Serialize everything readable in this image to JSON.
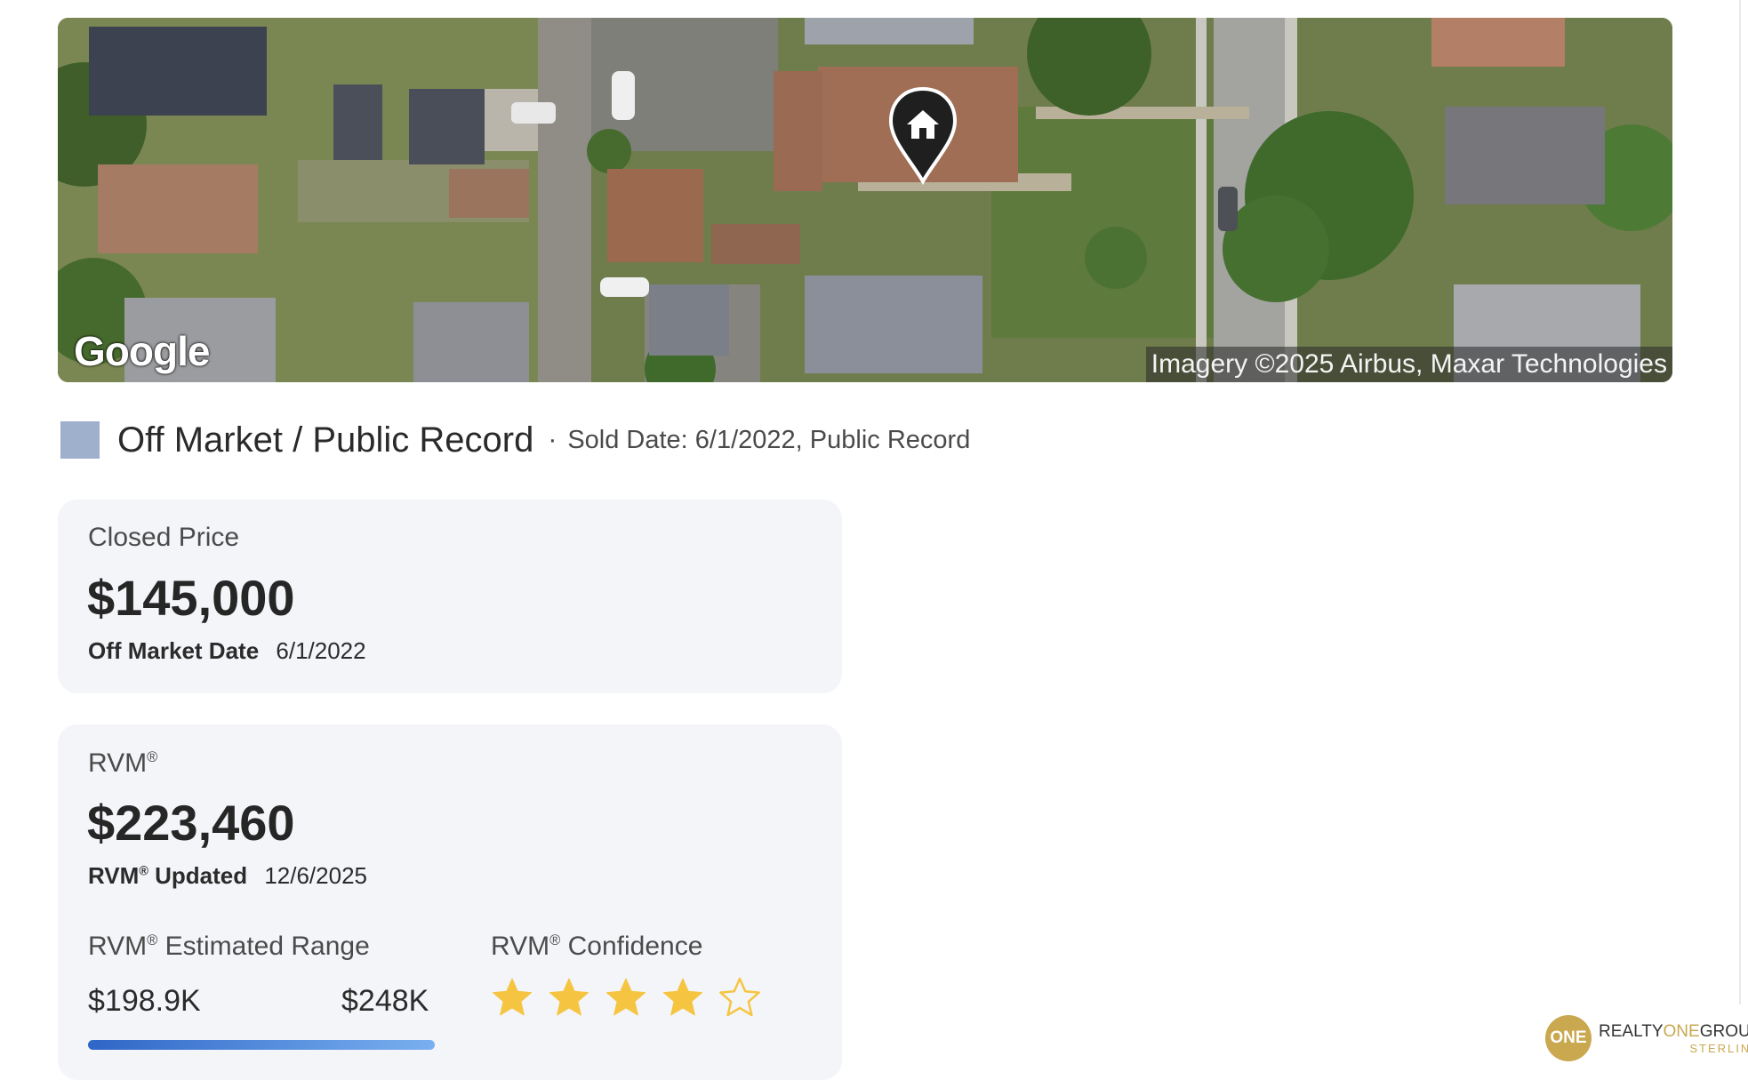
{
  "map": {
    "provider_label": "Google",
    "imagery_credit": "Imagery ©2025 Airbus, Maxar Technologies",
    "pin_icon": "home-pin-icon"
  },
  "status": {
    "swatch_color": "#9fb0cd",
    "title": "Off Market / Public Record",
    "separator": "·",
    "sold_info": "Sold Date: 6/1/2022, Public Record"
  },
  "closed_card": {
    "label": "Closed Price",
    "price": "$145,000",
    "off_market_label": "Off Market Date",
    "off_market_date": "6/1/2022"
  },
  "rvm_card": {
    "label": "RVM",
    "registered_mark": "®",
    "value": "$223,460",
    "updated_label": "Updated",
    "updated_date": "12/6/2025",
    "range_label": "Estimated Range",
    "range_low": "$198.9K",
    "range_high": "$248K",
    "range_fill_fraction": 1.0,
    "confidence_label": "Confidence",
    "confidence_stars": 4,
    "confidence_max": 5,
    "star_color": "#f5c542"
  },
  "brand": {
    "circle_text": "ONE",
    "name_part1": "REALTY",
    "name_part2": "ONE",
    "name_part3": "GROUP",
    "sub": "STERLING",
    "color": "#c9a84f"
  }
}
